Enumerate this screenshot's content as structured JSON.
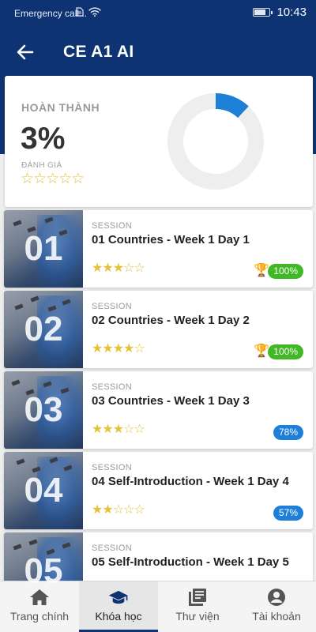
{
  "status_bar": {
    "carrier": "Emergency call...",
    "time": "10:43",
    "battery_level": 0.85
  },
  "app_bar": {
    "back_icon": "arrow-left-icon",
    "title": "CE A1 AI"
  },
  "summary": {
    "completion_label": "HOÀN THÀNH",
    "completion_percent": "3%",
    "completion_value": 3,
    "rating_label": "ĐÁNH GIÁ",
    "rating_stars": "☆☆☆☆☆",
    "rating_value": 0,
    "colors": {
      "progress": "#1e7fd8",
      "track": "#eeeeee"
    }
  },
  "sessions": [
    {
      "number": "01",
      "label": "SESSION",
      "title": "01 Countries - Week 1 Day 1",
      "stars": "★★★☆☆",
      "rating": 3,
      "trophy": true,
      "badge": "100%",
      "badge_color": "#41b826"
    },
    {
      "number": "02",
      "label": "SESSION",
      "title": "02 Countries - Week 1 Day 2",
      "stars": "★★★★☆",
      "rating": 4,
      "trophy": true,
      "badge": "100%",
      "badge_color": "#41b826"
    },
    {
      "number": "03",
      "label": "SESSION",
      "title": "03 Countries - Week 1 Day 3",
      "stars": "★★★☆☆",
      "rating": 3,
      "trophy": false,
      "badge": "78%",
      "badge_color": "#1e7fd8"
    },
    {
      "number": "04",
      "label": "SESSION",
      "title": "04 Self-Introduction - Week 1 Day 4",
      "stars": "★★☆☆☆",
      "rating": 2,
      "trophy": false,
      "badge": "57%",
      "badge_color": "#1e7fd8"
    },
    {
      "number": "05",
      "label": "SESSION",
      "title": "05 Self-Introduction - Week 1 Day 5",
      "stars": "",
      "rating": null,
      "trophy": false,
      "badge": "",
      "badge_color": "#1e7fd8"
    }
  ],
  "trophy_icon": "🏆",
  "bottom_nav": [
    {
      "label": "Trang chính",
      "icon": "home-icon",
      "active": false
    },
    {
      "label": "Khóa học",
      "icon": "graduation-cap-icon",
      "active": true
    },
    {
      "label": "Thư viện",
      "icon": "library-icon",
      "active": false
    },
    {
      "label": "Tài khoản",
      "icon": "account-icon",
      "active": false
    }
  ],
  "colors": {
    "primary": "#0d3372",
    "star": "#e3c338"
  }
}
